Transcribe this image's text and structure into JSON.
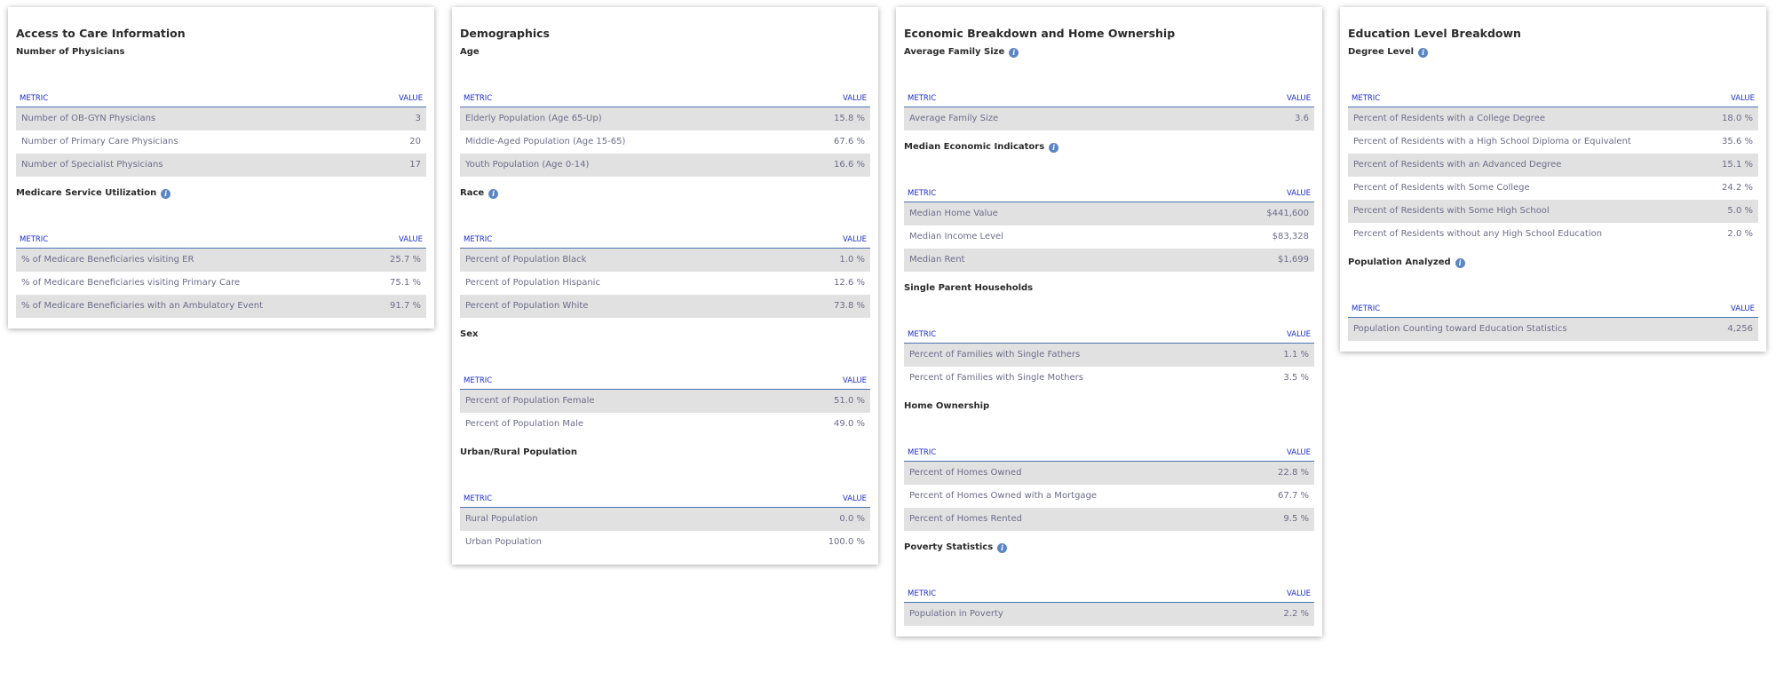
{
  "headers": {
    "metric": "METRIC",
    "value": "VALUE"
  },
  "cards": [
    {
      "title": "Access to Care Information",
      "sections": [
        {
          "title": "Number of Physicians",
          "info": false,
          "rows": [
            {
              "metric": "Number of OB-GYN Physicians",
              "value": "3"
            },
            {
              "metric": "Number of Primary Care Physicians",
              "value": "20"
            },
            {
              "metric": "Number of Specialist Physicians",
              "value": "17"
            }
          ]
        },
        {
          "title": "Medicare Service Utilization",
          "info": true,
          "rows": [
            {
              "metric": "% of Medicare Beneficiaries visiting ER",
              "value": "25.7 %"
            },
            {
              "metric": "% of Medicare Beneficiaries visiting Primary Care",
              "value": "75.1 %"
            },
            {
              "metric": "% of Medicare Beneficiaries with an Ambulatory Event",
              "value": "91.7 %"
            }
          ]
        }
      ]
    },
    {
      "title": "Demographics",
      "sections": [
        {
          "title": "Age",
          "info": false,
          "rows": [
            {
              "metric": "Elderly Population (Age 65-Up)",
              "value": "15.8 %"
            },
            {
              "metric": "Middle-Aged Population (Age 15-65)",
              "value": "67.6 %"
            },
            {
              "metric": "Youth Population (Age 0-14)",
              "value": "16.6 %"
            }
          ]
        },
        {
          "title": "Race",
          "info": true,
          "rows": [
            {
              "metric": "Percent of Population Black",
              "value": "1.0 %"
            },
            {
              "metric": "Percent of Population Hispanic",
              "value": "12.6 %"
            },
            {
              "metric": "Percent of Population White",
              "value": "73.8 %"
            }
          ]
        },
        {
          "title": "Sex",
          "info": false,
          "rows": [
            {
              "metric": "Percent of Population Female",
              "value": "51.0 %"
            },
            {
              "metric": "Percent of Population Male",
              "value": "49.0 %"
            }
          ]
        },
        {
          "title": "Urban/Rural Population",
          "info": false,
          "rows": [
            {
              "metric": "Rural Population",
              "value": "0.0 %"
            },
            {
              "metric": "Urban Population",
              "value": "100.0 %"
            }
          ]
        }
      ]
    },
    {
      "title": "Economic Breakdown and Home Ownership",
      "sections": [
        {
          "title": "Average Family Size",
          "info": true,
          "rows": [
            {
              "metric": "Average Family Size",
              "value": "3.6"
            }
          ]
        },
        {
          "title": "Median Economic Indicators",
          "info": true,
          "rows": [
            {
              "metric": "Median Home Value",
              "value": "$441,600"
            },
            {
              "metric": "Median Income Level",
              "value": "$83,328"
            },
            {
              "metric": "Median Rent",
              "value": "$1,699"
            }
          ]
        },
        {
          "title": "Single Parent Households",
          "info": false,
          "rows": [
            {
              "metric": "Percent of Families with Single Fathers",
              "value": "1.1 %"
            },
            {
              "metric": "Percent of Families with Single Mothers",
              "value": "3.5 %"
            }
          ]
        },
        {
          "title": "Home Ownership",
          "info": false,
          "rows": [
            {
              "metric": "Percent of Homes Owned",
              "value": "22.8 %"
            },
            {
              "metric": "Percent of Homes Owned with a Mortgage",
              "value": "67.7 %"
            },
            {
              "metric": "Percent of Homes Rented",
              "value": "9.5 %"
            }
          ]
        },
        {
          "title": "Poverty Statistics",
          "info": true,
          "rows": [
            {
              "metric": "Population in Poverty",
              "value": "2.2 %"
            }
          ]
        }
      ]
    },
    {
      "title": "Education Level Breakdown",
      "sections": [
        {
          "title": "Degree Level",
          "info": true,
          "rows": [
            {
              "metric": "Percent of Residents with a College Degree",
              "value": "18.0 %"
            },
            {
              "metric": "Percent of Residents with a High School Diploma or Equivalent",
              "value": "35.6 %"
            },
            {
              "metric": "Percent of Residents with an Advanced Degree",
              "value": "15.1 %"
            },
            {
              "metric": "Percent of Residents with Some College",
              "value": "24.2 %"
            },
            {
              "metric": "Percent of Residents with Some High School",
              "value": "5.0 %"
            },
            {
              "metric": "Percent of Residents without any High School Education",
              "value": "2.0 %"
            }
          ]
        },
        {
          "title": "Population Analyzed",
          "info": true,
          "rows": [
            {
              "metric": "Population Counting toward Education Statistics",
              "value": "4,256"
            }
          ]
        }
      ]
    }
  ]
}
